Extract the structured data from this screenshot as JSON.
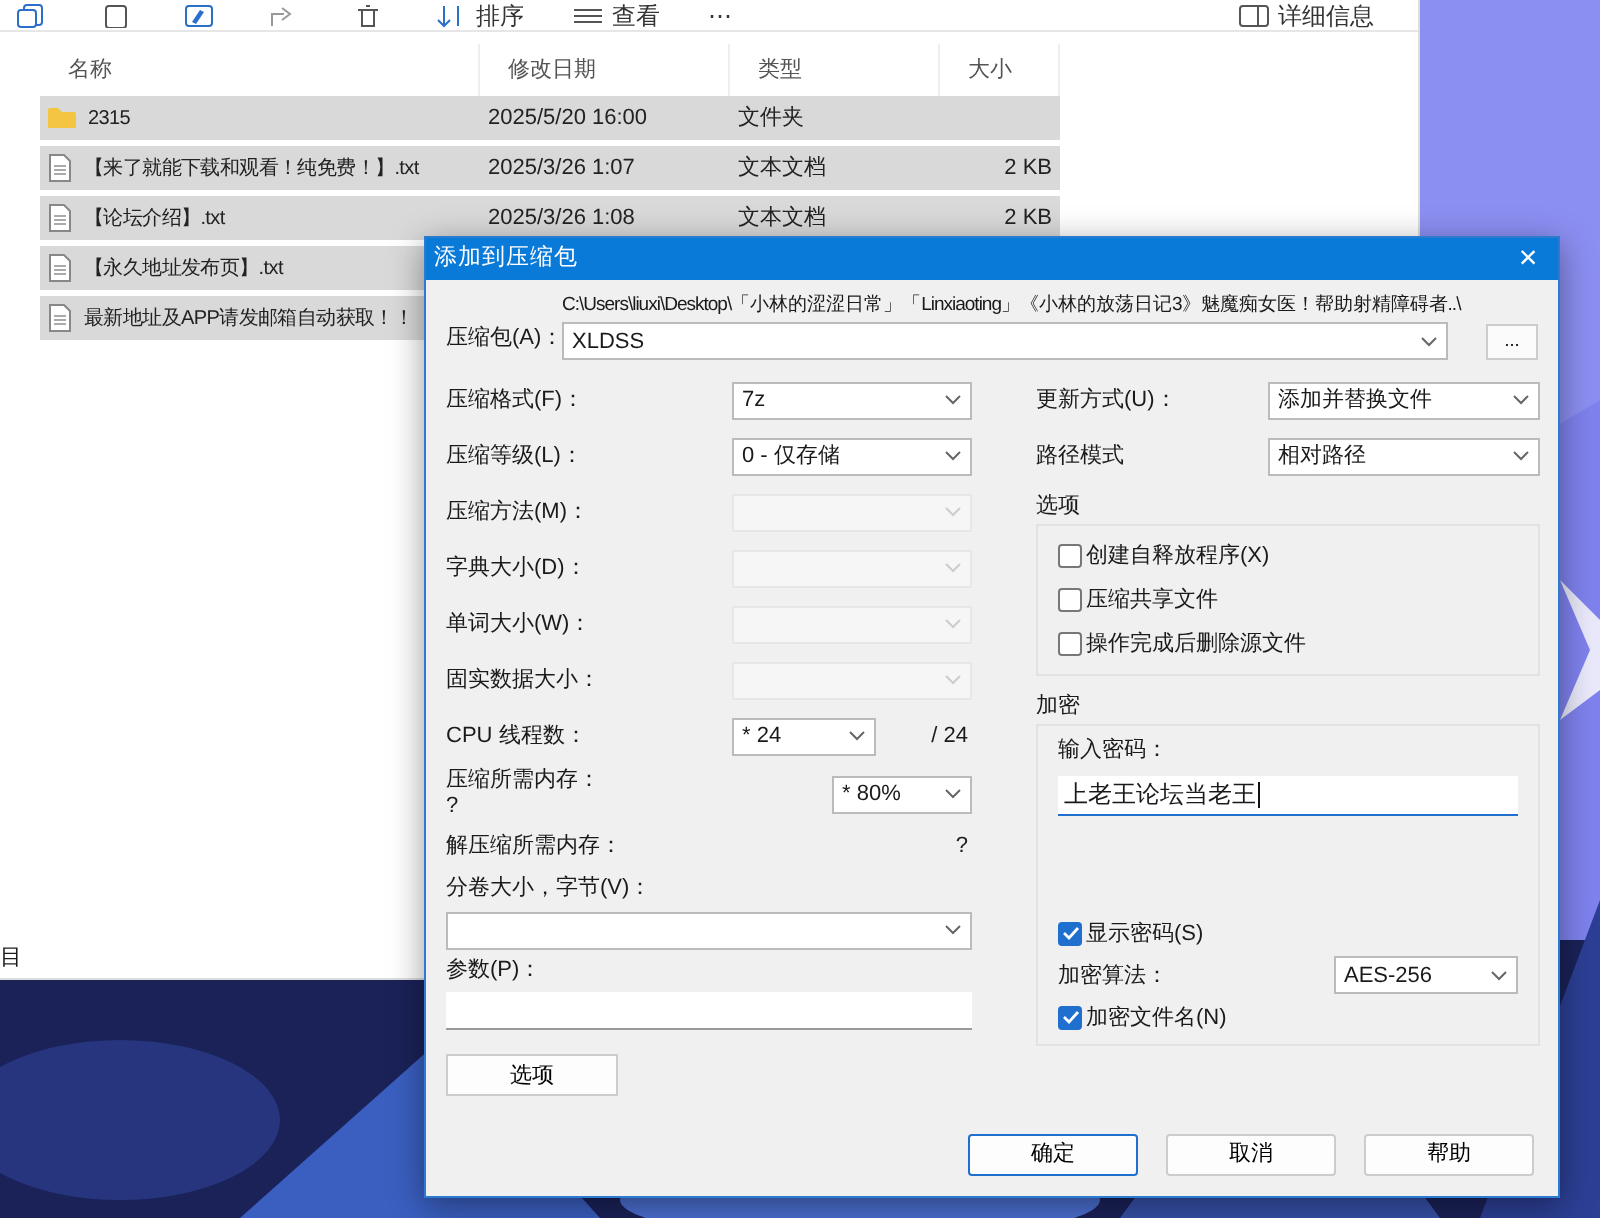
{
  "explorer": {
    "toolbar": [
      {
        "kind": "icon"
      },
      {
        "kind": "icon"
      },
      {
        "kind": "icon"
      },
      {
        "kind": "icon"
      },
      {
        "kind": "icon"
      },
      {
        "kind": "menu",
        "label": "排序"
      },
      {
        "kind": "menu",
        "label": "查看"
      },
      {
        "kind": "more",
        "label": "⋯"
      },
      {
        "kind": "details",
        "label": "详细信息"
      }
    ],
    "columns": [
      "名称",
      "修改日期",
      "类型",
      "大小"
    ],
    "rows": [
      {
        "kind": "folder",
        "name": "2315",
        "modified": "2025/5/20 16:00",
        "type": "文件夹",
        "selected": true
      },
      {
        "kind": "file",
        "name": "【来了就能下载和观看！纯免费！】.txt",
        "modified": "2025/3/26 1:07",
        "type": "文本文档",
        "size": "2 KB",
        "selected": true
      },
      {
        "kind": "file",
        "name": "【论坛介绍】.txt",
        "modified": "2025/3/26 1:08",
        "type": "文本文档",
        "size": "2 KB",
        "selected": true
      },
      {
        "kind": "file",
        "name": "【永久地址发布页】.txt",
        "selected": true
      },
      {
        "kind": "file",
        "name": "最新地址及APP请发邮箱自动获取！！",
        "selected": true
      }
    ],
    "status": "目"
  },
  "dialog": {
    "title": "添加到压缩包",
    "close": "×",
    "archive": {
      "label": "压缩包(A)：",
      "path": "C:\\Users\\liuxi\\Desktop\\「小林的涩涩日常」「Linxiaoting」《小林的放荡日记3》魅魔痴女医！帮助射精障碍者..\\",
      "value": "XLDSS",
      "browse": "..."
    },
    "left": [
      {
        "kind": "select",
        "label": "压缩格式(F)：",
        "value": "7z",
        "disabled": false
      },
      {
        "kind": "select",
        "label": "压缩等级(L)：",
        "value": "0 - 仅存储",
        "disabled": false
      },
      {
        "kind": "select",
        "label": "压缩方法(M)：",
        "disabled": true
      },
      {
        "kind": "select",
        "label": "字典大小(D)：",
        "disabled": true
      },
      {
        "kind": "select",
        "label": "单词大小(W)：",
        "disabled": true
      },
      {
        "kind": "select",
        "label": "固实数据大小：",
        "disabled": true
      },
      {
        "kind": "threads",
        "label": "CPU 线程数：",
        "value": "* 24",
        "suffix": "/ 24",
        "disabled": false
      },
      {
        "kind": "memory",
        "label": "压缩所需内存：",
        "note": "?",
        "value": "* 80%",
        "disabled": false
      },
      {
        "kind": "info",
        "label": "解压缩所需内存：",
        "value": "?"
      },
      {
        "kind": "wide_select",
        "label": "分卷大小，字节(V)："
      },
      {
        "kind": "wide_input",
        "label": "参数(P)："
      }
    ],
    "options_button": "选项",
    "update": {
      "label": "更新方式(U)：",
      "value": "添加并替换文件"
    },
    "path_mode": {
      "label": "路径模式",
      "value": "相对路径"
    },
    "options": {
      "title": "选项",
      "checkboxes": [
        {
          "label": "创建自释放程序(X)",
          "checked": false
        },
        {
          "label": "压缩共享文件",
          "checked": false
        },
        {
          "label": "操作完成后删除源文件",
          "checked": false
        }
      ]
    },
    "encryption": {
      "title": "加密",
      "password_label": "输入密码：",
      "password": "上老王论坛当老王",
      "show_password": {
        "label": "显示密码(S)",
        "checked": true
      },
      "algorithm": {
        "label": "加密算法：",
        "value": "AES-256"
      },
      "encrypt_names": {
        "label": "加密文件名(N)",
        "checked": true
      }
    },
    "buttons": [
      {
        "label": "确定",
        "default": true
      },
      {
        "label": "取消",
        "default": false
      },
      {
        "label": "帮助",
        "default": false
      }
    ]
  }
}
